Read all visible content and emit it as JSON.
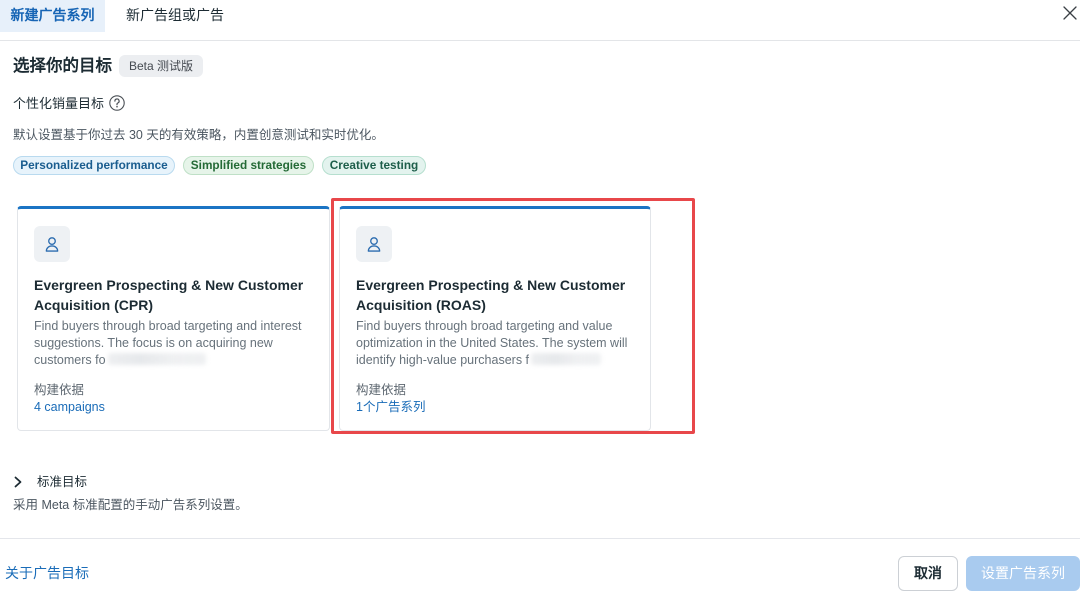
{
  "tabs": [
    {
      "label": "新建广告系列",
      "active": true
    },
    {
      "label": "新广告组或广告",
      "active": false
    }
  ],
  "icons": {
    "close": "close-icon",
    "help": "question-circle-icon",
    "card": "person-icon",
    "expand": "chevron-right-icon"
  },
  "objective": {
    "title": "选择你的目标",
    "badge": "Beta 测试版"
  },
  "personalized": {
    "heading": "个性化销量目标",
    "description": "默认设置基于你过去 30 天的有效策略，内置创意测试和实时优化。",
    "tags": [
      {
        "label": "Personalized performance",
        "color": "#1a5d8f",
        "background": "#e7f3fb"
      },
      {
        "label": "Simplified strategies",
        "color": "#246a36",
        "background": "#e6f4e9"
      },
      {
        "label": "Creative testing",
        "color": "#1d5e4a",
        "background": "#e3f3ee"
      }
    ]
  },
  "cards": [
    {
      "title": "Evergreen Prospecting & New Customer Acquisition (CPR)",
      "description": "Find buyers through broad targeting and interest suggestions. The focus is on acquiring new customers fo",
      "based_on_label": "构建依据",
      "based_on_link": "4 campaigns",
      "highlighted": false
    },
    {
      "title": "Evergreen Prospecting & New Customer Acquisition (ROAS)",
      "description": "Find buyers through broad targeting and value optimization in the United States. The system will identify high-value purchasers f",
      "based_on_label": "构建依据",
      "based_on_link": "1个广告系列",
      "highlighted": true
    }
  ],
  "standard": {
    "heading": "标准目标",
    "description": "采用 Meta 标准配置的手动广告系列设置。"
  },
  "footer": {
    "about_link": "关于广告目标",
    "cancel_label": "取消",
    "submit_label": "设置广告系列",
    "submit_disabled": true
  },
  "colors": {
    "accent": "#1b74c4",
    "link": "#1a6cb8",
    "highlight": "#e8474a",
    "submit_disabled_bg": "#a9cbef"
  }
}
